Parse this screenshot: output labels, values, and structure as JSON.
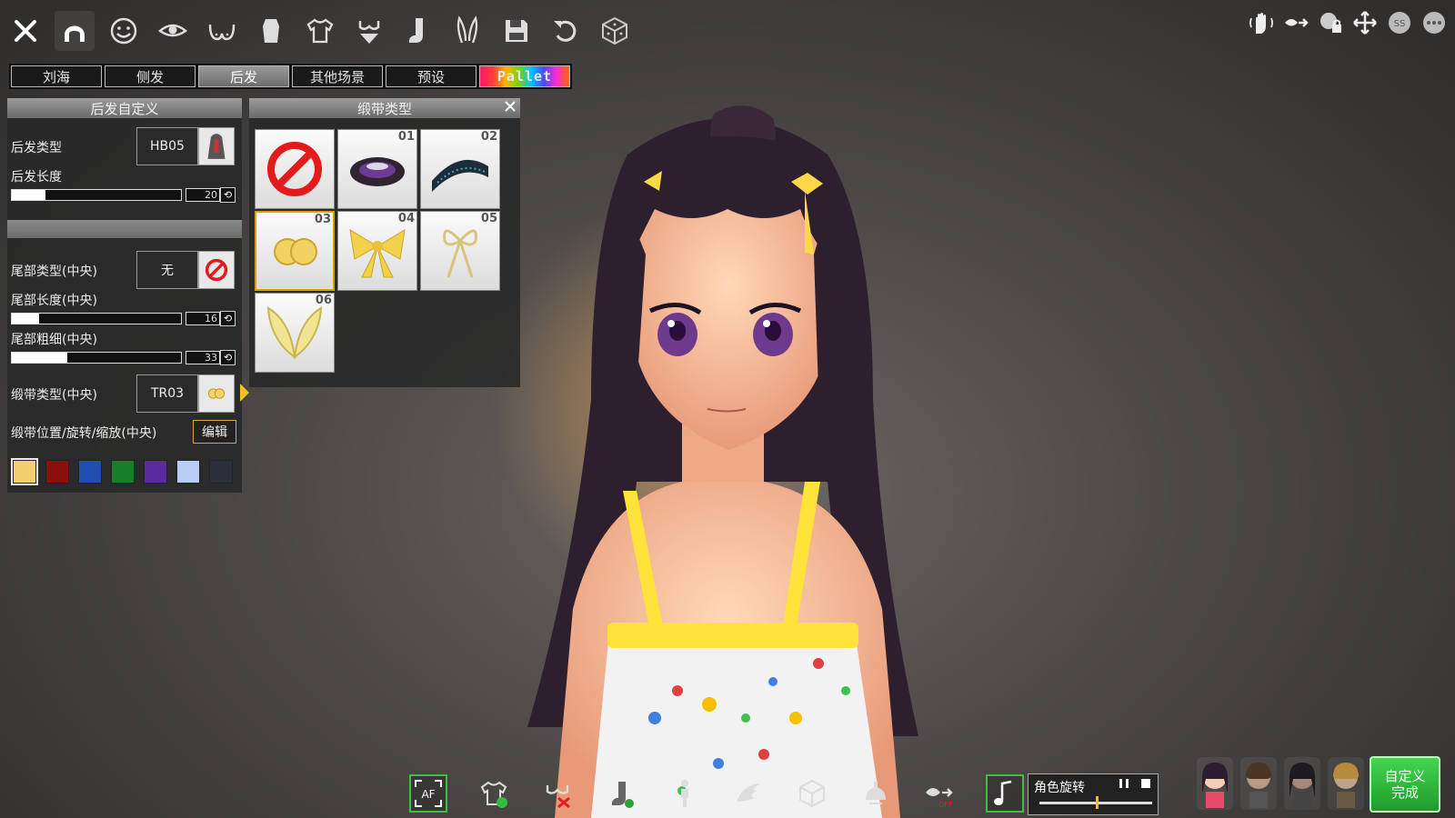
{
  "tabs": [
    {
      "label": "刘海"
    },
    {
      "label": "侧发"
    },
    {
      "label": "后发"
    },
    {
      "label": "其他场景"
    },
    {
      "label": "预设"
    },
    {
      "label": "Pallet"
    }
  ],
  "active_tab": "后发",
  "left_panel": {
    "header": "后发自定义",
    "back_hair_type_label": "后发类型",
    "back_hair_type_value": "HB05",
    "back_hair_length_label": "后发长度",
    "back_hair_length_value": "20",
    "back_hair_length_fraction": 0.2,
    "tail_type_label": "尾部类型(中央)",
    "tail_type_value": "无",
    "tail_length_label": "尾部长度(中央)",
    "tail_length_value": "16",
    "tail_length_fraction": 0.16,
    "tail_thickness_label": "尾部粗细(中央)",
    "tail_thickness_value": "33",
    "tail_thickness_fraction": 0.33,
    "ribbon_type_label": "缎带类型(中央)",
    "ribbon_type_value": "TR03",
    "ribbon_transform_label": "缎带位置/旋转/缩放(中央)",
    "edit_button": "编辑",
    "swatches": [
      "#f3d06e",
      "#8a1010",
      "#1f4fb0",
      "#15802a",
      "#5a2aa0",
      "#b8ccf5",
      "#2a2f3a"
    ]
  },
  "ribbon_picker": {
    "header": "缎带类型",
    "items": [
      {
        "num": ""
      },
      {
        "num": "01"
      },
      {
        "num": "02"
      },
      {
        "num": "03"
      },
      {
        "num": "04"
      },
      {
        "num": "05"
      },
      {
        "num": "06"
      }
    ],
    "selected": "03"
  },
  "rotation": {
    "label": "角色旋转"
  },
  "done_button": {
    "line1": "自定义",
    "line2": "完成"
  }
}
